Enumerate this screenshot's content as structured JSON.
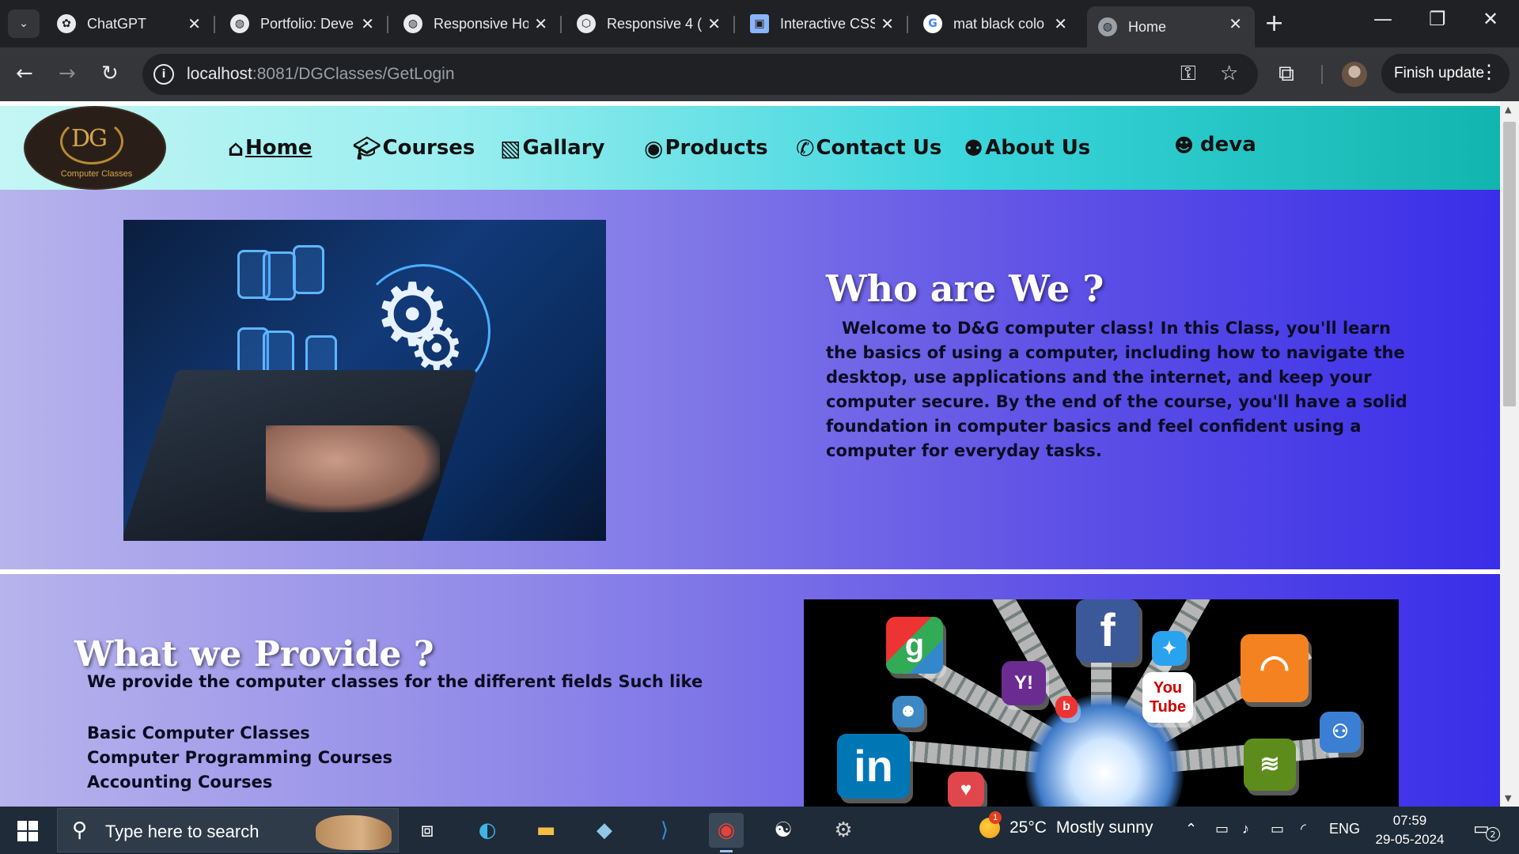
{
  "browser": {
    "tabs": [
      {
        "title": "ChatGPT",
        "favicon": "chatgpt-icon"
      },
      {
        "title": "Portfolio: Deve",
        "favicon": "globe-icon"
      },
      {
        "title": "Responsive Ho",
        "favicon": "globe-icon"
      },
      {
        "title": "Responsive 4 (",
        "favicon": "codepen-icon"
      },
      {
        "title": "Interactive CSS",
        "favicon": "cube-icon"
      },
      {
        "title": "mat black colo",
        "favicon": "google-icon"
      },
      {
        "title": "Home",
        "favicon": "globe-icon",
        "active": true
      }
    ],
    "url_host": "localhost",
    "url_path": ":8081/DGClasses/GetLogin",
    "update_button": "Finish update"
  },
  "site": {
    "logo": {
      "monogram": "DG",
      "subtitle": "Computer Classes"
    },
    "nav": [
      {
        "label": "Home",
        "icon": "home-icon"
      },
      {
        "label": "Courses",
        "icon": "graduation-cap-icon"
      },
      {
        "label": "Gallary",
        "icon": "images-icon"
      },
      {
        "label": "Products",
        "icon": "record-icon"
      },
      {
        "label": "Contact Us",
        "icon": "phone-icon"
      },
      {
        "label": "About Us",
        "icon": "people-icon"
      }
    ],
    "user": {
      "name": "deva",
      "icon": "user-circle-icon"
    },
    "who": {
      "title": "Who are We ?",
      "body": "Welcome to D&G computer class! In this Class, you'll learn the basics of using a computer, including how to navigate the desktop, use applications and the internet, and keep your computer secure. By the end of the course, you'll have a solid foundation in computer basics and feel confident using a computer for everyday tasks."
    },
    "provide": {
      "title": "What we Provide ?",
      "intro": "We provide the computer classes for the different fields Such like",
      "items": [
        "Basic Computer Classes",
        "Computer Programming Courses",
        "Accounting Courses"
      ]
    },
    "social_labels": {
      "youtube": "You Tube",
      "linkedin": "in",
      "facebook": "f",
      "yahoo": "Y!"
    },
    "colors": {
      "nav_start": "#c4f6f4",
      "nav_end": "#12b5ae",
      "section_start": "#b7b3ec",
      "section_end": "#3a2ee8"
    }
  },
  "taskbar": {
    "search_placeholder": "Type here to search",
    "weather": {
      "temp": "25°C",
      "condition": "Mostly sunny",
      "badge": "1"
    },
    "language": "ENG",
    "time": "07:59",
    "date": "29-05-2024",
    "notifications": "2"
  }
}
